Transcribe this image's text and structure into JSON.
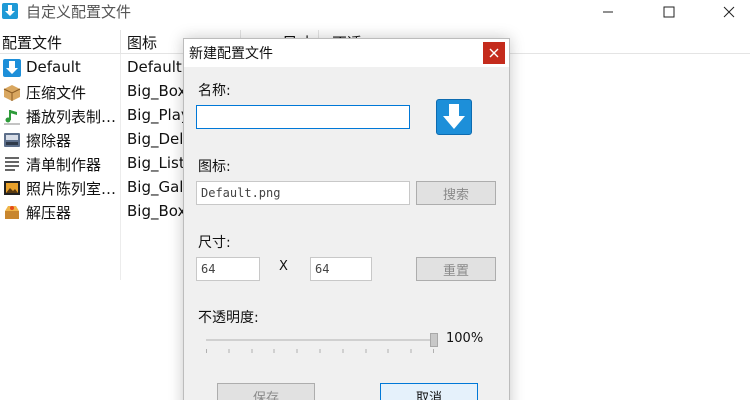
{
  "window": {
    "title": "自定义配置文件"
  },
  "list": {
    "columns": [
      "配置文件",
      "图标",
      "尺寸",
      "不透"
    ],
    "rows": [
      {
        "name": "Default",
        "icon_file": "Default.png",
        "icon": "download-arrow-icon"
      },
      {
        "name": "压缩文件",
        "icon_file": "Big_Box",
        "icon": "box-icon"
      },
      {
        "name": "播放列表制…",
        "icon_file": "Big_Play",
        "icon": "music-note-icon"
      },
      {
        "name": "擦除器",
        "icon_file": "Big_Dele",
        "icon": "eraser-icon"
      },
      {
        "name": "清单制作器",
        "icon_file": "Big_List",
        "icon": "list-icon"
      },
      {
        "name": "照片陈列室…",
        "icon_file": "Big_Gall",
        "icon": "picture-icon"
      },
      {
        "name": "解压器",
        "icon_file": "Big_Box",
        "icon": "open-box-icon"
      }
    ]
  },
  "dialog": {
    "title": "新建配置文件",
    "name_label": "名称:",
    "name_value": "",
    "icon_label": "图标:",
    "icon_value": "Default.png",
    "browse_label": "搜索",
    "size_label": "尺寸:",
    "width_value": "64",
    "size_separator": "X",
    "height_value": "64",
    "reset_label": "重置",
    "opacity_label": "不透明度:",
    "opacity_value": 100,
    "opacity_text": "100%",
    "save_label": "保存",
    "cancel_label": "取消"
  },
  "colors": {
    "accent": "#0078d7",
    "close": "#c42b1c",
    "icon_blue": "#1d8fd9"
  }
}
